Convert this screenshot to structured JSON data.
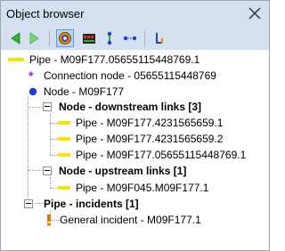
{
  "window": {
    "title": "Object browser"
  },
  "toolbar": {
    "buttons": [
      {
        "icon": "back-arrow-icon",
        "color": "#2fb12f"
      },
      {
        "icon": "forward-arrow-icon",
        "color": "#7fd57f"
      },
      {
        "icon": "target-icon",
        "selected": true
      },
      {
        "icon": "network-icon"
      },
      {
        "icon": "node-chain-icon"
      },
      {
        "icon": "link-chain-icon"
      },
      {
        "icon": "level-icon"
      }
    ]
  },
  "tree": {
    "pipe": {
      "label": "Pipe - M09F177.05655115448769.1"
    },
    "connection_node": {
      "label": "Connection node - 05655115448769"
    },
    "node": {
      "label": "Node - M09F177"
    },
    "downstream": {
      "label": "Node - downstream links [3]",
      "items": [
        "Pipe - M09F177.4231565659.1",
        "Pipe - M09F177.4231565659.2",
        "Pipe - M09F177.05655115448769.1"
      ]
    },
    "upstream": {
      "label": "Node - upstream links [1]",
      "items": [
        "Pipe - M09F045.M09F177.1"
      ]
    },
    "incidents": {
      "label": "Pipe - incidents [1]",
      "items": [
        "General incident - M09F177.1"
      ]
    }
  },
  "colors": {
    "pipe": "#f2e600",
    "connection_node": "#a020f0",
    "node": "#1f3fd0",
    "incident": "#e07a00",
    "titlebar": "#d4e0ef"
  }
}
